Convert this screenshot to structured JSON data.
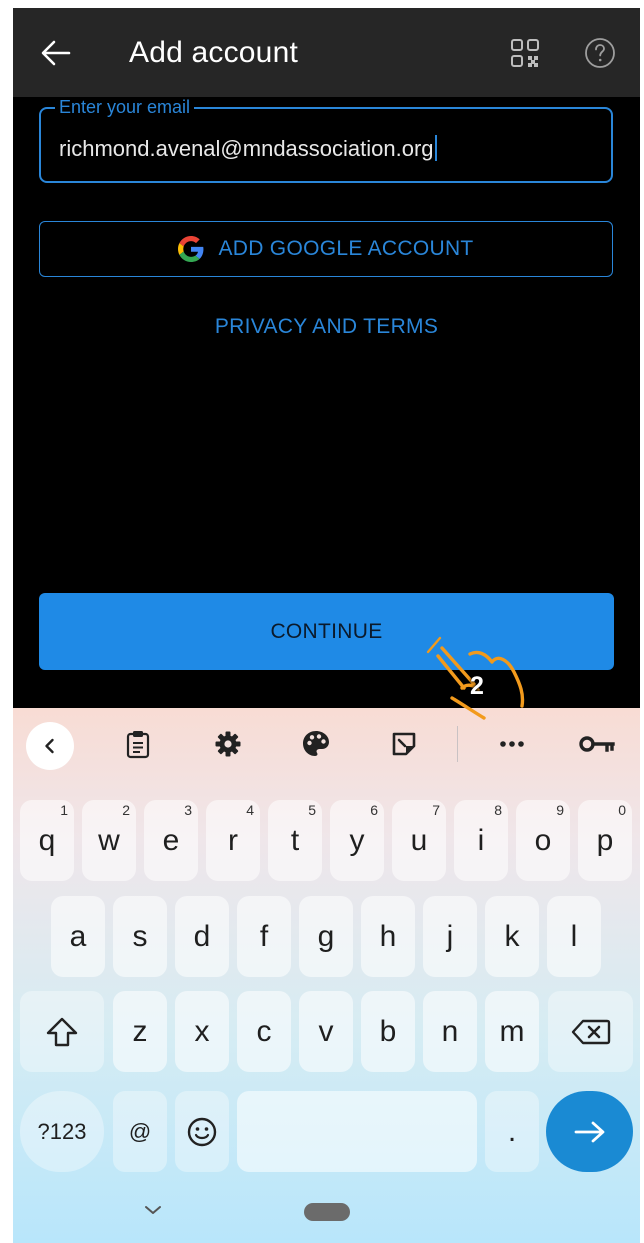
{
  "app_bar": {
    "title": "Add account",
    "back_icon": "arrow-left-icon",
    "qr_icon": "qr-code-icon",
    "help_icon": "help-circle-icon"
  },
  "email": {
    "label": "Enter your email",
    "value": "richmond.avenal@mndassociation.org"
  },
  "google_button": {
    "label": "ADD GOOGLE ACCOUNT"
  },
  "privacy_link": {
    "label": "PRIVACY AND TERMS"
  },
  "continue_button": {
    "label": "CONTINUE"
  },
  "annotation": {
    "step": "2"
  },
  "keyboard": {
    "toolbar_icons": [
      "chevron-left-icon",
      "clipboard-icon",
      "gear-icon",
      "palette-icon",
      "sticker-icon",
      "more-icon",
      "key-icon"
    ],
    "row1": [
      {
        "c": "q",
        "h": "1"
      },
      {
        "c": "w",
        "h": "2"
      },
      {
        "c": "e",
        "h": "3"
      },
      {
        "c": "r",
        "h": "4"
      },
      {
        "c": "t",
        "h": "5"
      },
      {
        "c": "y",
        "h": "6"
      },
      {
        "c": "u",
        "h": "7"
      },
      {
        "c": "i",
        "h": "8"
      },
      {
        "c": "o",
        "h": "9"
      },
      {
        "c": "p",
        "h": "0"
      }
    ],
    "row2": [
      "a",
      "s",
      "d",
      "f",
      "g",
      "h",
      "j",
      "k",
      "l"
    ],
    "row3": [
      "z",
      "x",
      "c",
      "v",
      "b",
      "n",
      "m"
    ],
    "sym_label": "?123",
    "at_label": "@",
    "period_label": "."
  },
  "colors": {
    "accent": "#2a86d9",
    "continue_bg": "#1f8ae6",
    "appbar_bg": "#262626",
    "enter_key": "#1a8ad3",
    "hand_stroke": "#f29a1c"
  }
}
